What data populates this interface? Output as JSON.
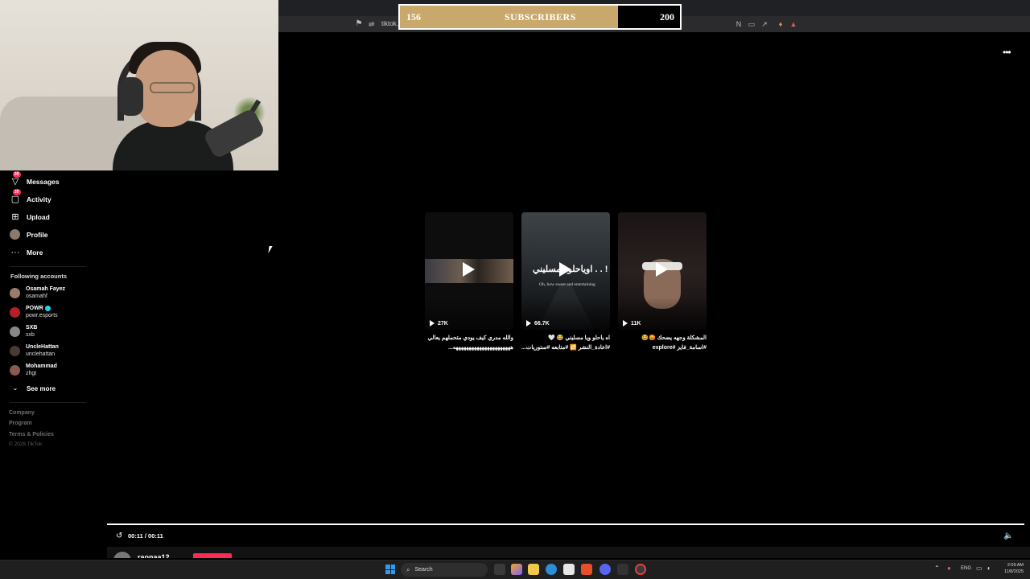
{
  "browser": {
    "url": "tiktok.c",
    "url_tail": "2"
  },
  "goal": {
    "start": "156",
    "label": "SUBSCRIBERS",
    "target": "200",
    "progress_fraction": 0.78,
    "fill_color": "#c9a96b"
  },
  "sidebar": {
    "items": [
      {
        "label": "Messages",
        "icon": "send-icon",
        "badge": "99"
      },
      {
        "label": "Activity",
        "icon": "inbox-icon",
        "badge": "30"
      },
      {
        "label": "Upload",
        "icon": "plus-square-icon"
      },
      {
        "label": "Profile",
        "icon": "avatar"
      },
      {
        "label": "More",
        "icon": "ellipsis-icon"
      }
    ],
    "following_title": "Following accounts",
    "following": [
      {
        "name": "Osamah Fayez",
        "handle": "osamahf"
      },
      {
        "name": "POWR",
        "handle": "powr.esports"
      },
      {
        "name": "SXB",
        "handle": "sxb"
      },
      {
        "name": "UncleHattan",
        "handle": "unclehattan"
      },
      {
        "name": "Mohammad",
        "handle": "zhgt"
      }
    ],
    "see_more": "See more",
    "footer": [
      "Company",
      "Program",
      "Terms & Policies"
    ],
    "copyright": "© 2025 TikTok"
  },
  "videos": [
    {
      "views": "27K",
      "caption": "والله مدري كيف يودي متحملهم يعالي ههههههههههههههههههههههه..."
    },
    {
      "views": "66.7K",
      "caption": "اه ياحلو ويا مسليني 😂 🤍 #اعادة_النشر 🔁 #متابعه #ستوريات...",
      "overlay_ar": "اوياحلو ومسليني . . !",
      "overlay_en": "Oh, how sweet and entertaining"
    },
    {
      "views": "11K",
      "caption": "المشكلة وجهه يضحك 😡😂 #اسامة_فايز #explore"
    }
  ],
  "player": {
    "time": "00:11 / 00:11",
    "progress_fraction": 1.0,
    "username": "raonaa12"
  },
  "taskbar": {
    "search_label": "Search",
    "lang": "ENG",
    "time": "2:09 AM",
    "date": "11/8/2025"
  }
}
